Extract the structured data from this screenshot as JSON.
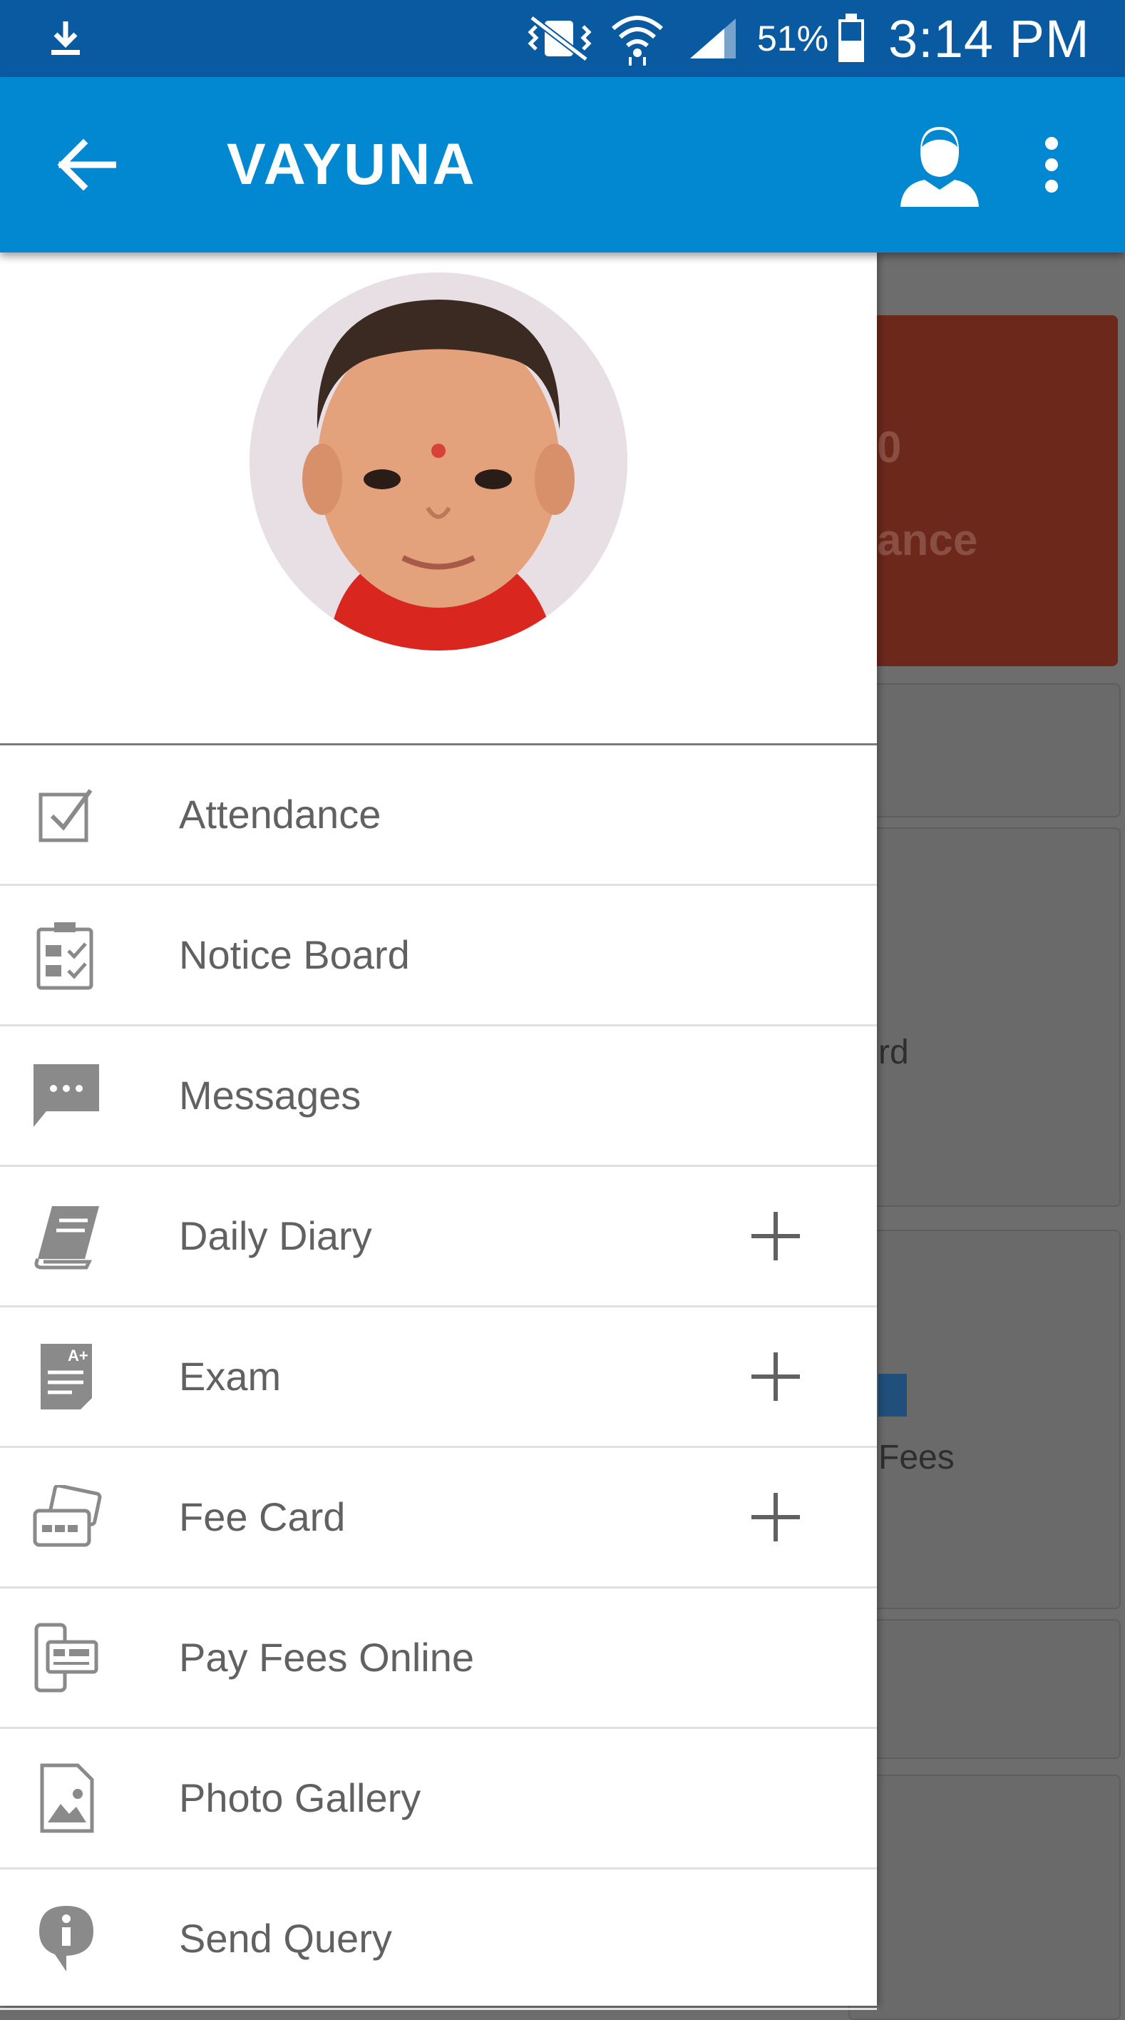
{
  "status_bar": {
    "battery": "51%",
    "time": "3:14 PM"
  },
  "app_bar": {
    "title": "VAYUNA"
  },
  "background": {
    "card_partial_text_1": "0",
    "card_partial_text_2": "ance",
    "card_partial_text_3": "rd",
    "card_partial_text_4": "Fees",
    "card_partial_text_5": "",
    "accent_card_color": "#6b281b"
  },
  "drawer": {
    "menu": [
      {
        "label": "Attendance",
        "icon": "check-square-icon",
        "expandable": false
      },
      {
        "label": "Notice Board",
        "icon": "notice-board-icon",
        "expandable": false
      },
      {
        "label": "Messages",
        "icon": "message-icon",
        "expandable": false
      },
      {
        "label": "Daily Diary",
        "icon": "diary-book-icon",
        "expandable": true
      },
      {
        "label": "Exam",
        "icon": "exam-sheet-icon",
        "expandable": true
      },
      {
        "label": "Fee Card",
        "icon": "fee-card-icon",
        "expandable": true
      },
      {
        "label": "Pay Fees Online",
        "icon": "pay-online-icon",
        "expandable": false
      },
      {
        "label": "Photo Gallery",
        "icon": "photo-gallery-icon",
        "expandable": false
      },
      {
        "label": "Send Query",
        "icon": "info-query-icon",
        "expandable": false
      }
    ]
  },
  "colors": {
    "status_bar": "#0a5aa2",
    "app_bar": "#0288d1",
    "scrim": "#6d6d6d",
    "menu_text": "#616161"
  }
}
